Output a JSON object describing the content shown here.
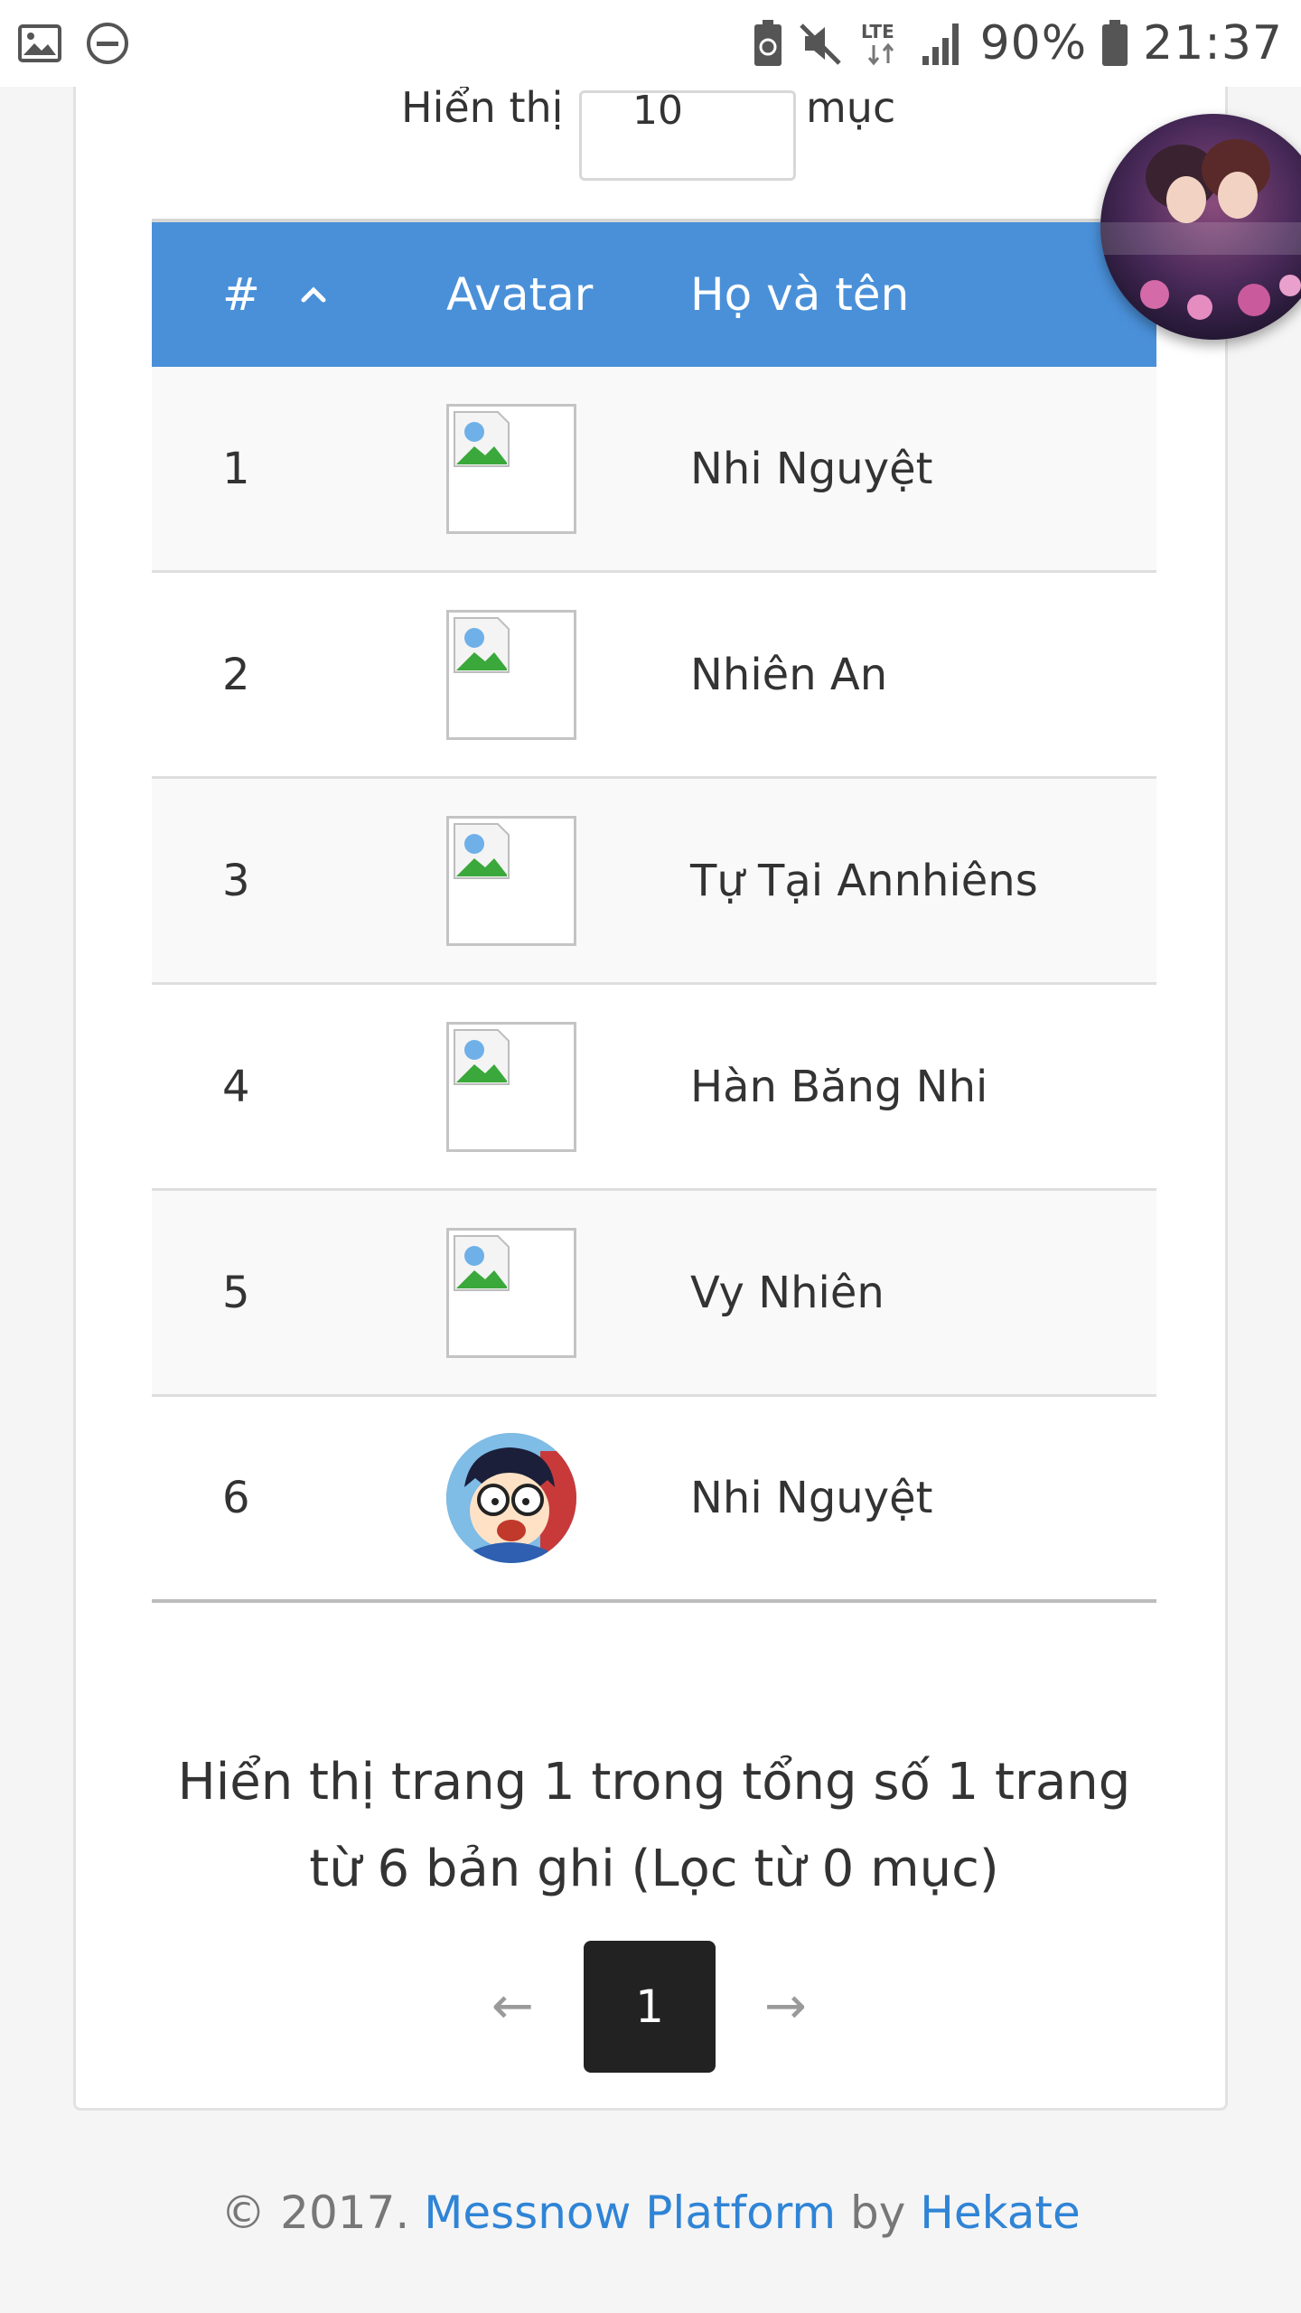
{
  "status_bar": {
    "battery": "90%",
    "time": "21:37",
    "network": "LTE",
    "icons": [
      "gallery-icon",
      "do-not-disturb-icon",
      "battery-saver-icon",
      "mute-icon",
      "lte-icon",
      "signal-icon",
      "battery-icon"
    ]
  },
  "length_menu": {
    "label_before": "Hiển thị",
    "value": "10",
    "label_after": "mục"
  },
  "table": {
    "columns": [
      "#",
      "Avatar",
      "Họ và tên"
    ],
    "rows": [
      {
        "num": "1",
        "name": "Nhi Nguyệt",
        "avatar": "broken"
      },
      {
        "num": "2",
        "name": "Nhiên An",
        "avatar": "broken"
      },
      {
        "num": "3",
        "name": "Tự Tại Annhiêns",
        "avatar": "broken"
      },
      {
        "num": "4",
        "name": "Hàn Băng Nhi",
        "avatar": "broken"
      },
      {
        "num": "5",
        "name": "Vy Nhiên",
        "avatar": "broken"
      },
      {
        "num": "6",
        "name": "Nhi Nguyệt",
        "avatar": "photo"
      }
    ]
  },
  "info": {
    "line1": "Hiển thị trang 1 trong tổng số 1 trang",
    "line2": "từ 6 bản ghi (Lọc từ 0 mục)"
  },
  "pagination": {
    "prev": "←",
    "current": "1",
    "next": "→"
  },
  "footer": {
    "prefix": "© 2017.",
    "platform_link": "Messnow Platform",
    "by": "by",
    "author_link": "Hekate"
  },
  "colors": {
    "header_blue": "#4a90d9",
    "link_blue": "#2f84d6",
    "pagination_active": "#222222"
  }
}
